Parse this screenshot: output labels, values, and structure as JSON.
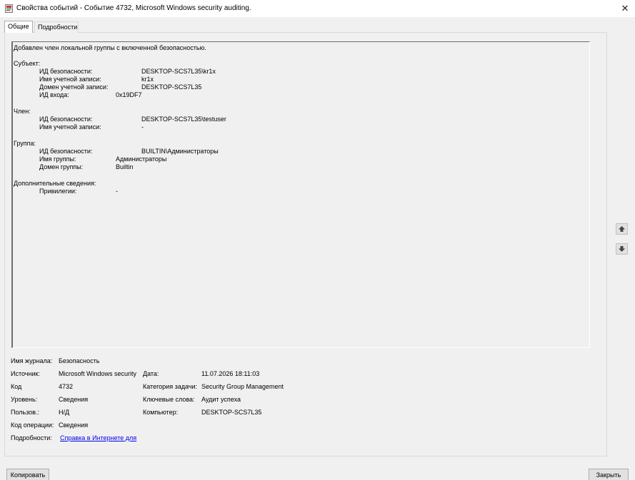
{
  "window": {
    "title": "Свойства событий - Событие 4732, Microsoft Windows security auditing.",
    "close_glyph": "✕"
  },
  "tabs": [
    {
      "label": "Общие"
    },
    {
      "label": "Подробности"
    }
  ],
  "description": {
    "lines": [
      "Добавлен член локальной группы с включенной безопасностью.",
      "Субъект:",
      "ИД безопасности:",
      "DESKTOP-SCS7L35\\kr1x",
      "Имя учетной записи:",
      "kr1x",
      "Домен учетной записи:",
      "DESKTOP-SCS7L35",
      "ИД входа:",
      "0x19DF7",
      "Член:",
      "ИД безопасности:",
      "DESKTOP-SCS7L35\\testuser",
      "Имя учетной записи:",
      "-",
      "Группа:",
      "ИД безопасности:",
      "BUILTIN\\Администраторы",
      "Имя группы:",
      "Администраторы",
      "Домен группы:",
      "Builtin",
      "Дополнительные сведения:",
      "Привилегии:",
      "-"
    ]
  },
  "info": {
    "log_label": "Имя журнала:",
    "log_value": "Безопасность",
    "source_label": "Источник:",
    "source_value": "Microsoft Windows security",
    "date_label": "Дата:",
    "date_value": "11.07.2026 18:11:03",
    "code_label": "Код",
    "code_value": "4732",
    "task_label": "Категория задачи:",
    "task_value": "Security Group Management",
    "level_label": "Уровень:",
    "level_value": "Сведения",
    "keywords_label": "Ключевые слова:",
    "keywords_value": "Аудит успеха",
    "user_label": "Пользов.:",
    "user_value": "Н/Д",
    "computer_label": "Компьютер:",
    "computer_value": "DESKTOP-SCS7L35",
    "opcode_label": "Код операции:",
    "opcode_value": "Сведения",
    "details_label": "Подробности:",
    "details_link": "Справка в Интернете для"
  },
  "buttons": {
    "copy": "Копировать",
    "close": "Закрыть"
  },
  "icons": {
    "app": "event-viewer-icon",
    "up": "up-arrow-icon",
    "down": "down-arrow-icon"
  }
}
